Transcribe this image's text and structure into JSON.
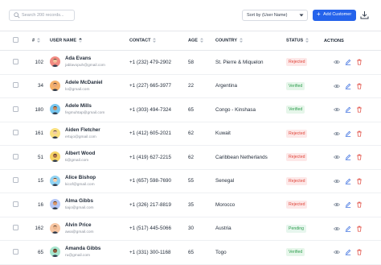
{
  "toolbar": {
    "search_placeholder": "Search 200 records...",
    "sort_label": "Sort by (User Name)",
    "add_label": "Add Customer"
  },
  "columns": {
    "index": "#",
    "user": "USER NAME",
    "contact": "CONTACT",
    "age": "AGE",
    "country": "COUNTRY",
    "status": "STATUS",
    "actions": "ACTIONS"
  },
  "colors": {
    "accent": "#2563eb",
    "rejected": "#e0463b",
    "verified": "#2e9e4e",
    "view_icon": "#8b95a3",
    "edit_icon": "#3b6fe0",
    "delete_icon": "#e0463b"
  },
  "rows": [
    {
      "index": "102",
      "name": "Ada Evans",
      "email": "jablavopuh@gmail.com",
      "contact": "+1 (232) 479-2902",
      "age": "58",
      "country": "St. Pierre & Miquelon",
      "status": "Rejected",
      "avatar_bg": "#f28b82"
    },
    {
      "index": "34",
      "name": "Adele McDaniel",
      "email": "lo@gmail.com",
      "contact": "+1 (227) 665-3977",
      "age": "22",
      "country": "Argentina",
      "status": "Verified",
      "avatar_bg": "#f6b26b"
    },
    {
      "index": "180",
      "name": "Adele Mills",
      "email": "fegmuhtap@gmail.com",
      "contact": "+1 (303) 494-7324",
      "age": "65",
      "country": "Congo - Kinshasa",
      "status": "Verified",
      "avatar_bg": "#76c7f0"
    },
    {
      "index": "161",
      "name": "Aiden Fletcher",
      "email": "ertujo@gmail.com",
      "contact": "+1 (412) 605-2021",
      "age": "62",
      "country": "Kuwait",
      "status": "Rejected",
      "avatar_bg": "#f9e07f"
    },
    {
      "index": "51",
      "name": "Albert Wood",
      "email": "ti@gmail.com",
      "contact": "+1 (419) 627-2215",
      "age": "62",
      "country": "Caribbean Netherlands",
      "status": "Rejected",
      "avatar_bg": "#f6d365"
    },
    {
      "index": "15",
      "name": "Alice Bishop",
      "email": "kicof@gmail.com",
      "contact": "+1 (657) 598-7690",
      "age": "55",
      "country": "Senegal",
      "status": "Rejected",
      "avatar_bg": "#8fd3f4"
    },
    {
      "index": "16",
      "name": "Alma Gibbs",
      "email": "tiajo@gmail.com",
      "contact": "+1 (326) 217-8819",
      "age": "35",
      "country": "Morocco",
      "status": "Rejected",
      "avatar_bg": "#b5c7f7"
    },
    {
      "index": "162",
      "name": "Alvin Price",
      "email": "awa@gmail.com",
      "contact": "+1 (517) 445-5066",
      "age": "30",
      "country": "Austria",
      "status": "Pending",
      "avatar_bg": "#f7c6a3"
    },
    {
      "index": "65",
      "name": "Amanda Gibbs",
      "email": "ru@gmail.com",
      "contact": "+1 (331) 300-1168",
      "age": "65",
      "country": "Togo",
      "status": "Verified",
      "avatar_bg": "#a8e6cf"
    }
  ]
}
